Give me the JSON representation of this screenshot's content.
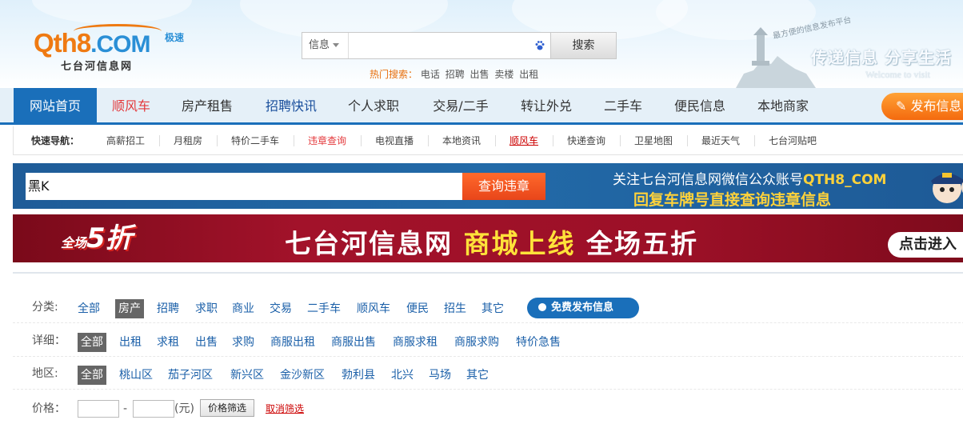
{
  "header": {
    "logo_text": "Qth8",
    "logo_com": ".COM",
    "logo_badge": "极速",
    "logo_sub": "七台河信息网",
    "search_type": "信息",
    "search_value": "",
    "search_button": "搜索",
    "hot_label": "热门搜索：",
    "hot_words": [
      "电话",
      "招聘",
      "出售",
      "卖楼",
      "出租"
    ],
    "tagline": "最方便的信息发布平台",
    "slogan": "传递信息 分享生活",
    "slogan_en": "Welcome to visit"
  },
  "nav": {
    "items": [
      "网站首页",
      "顺风车",
      "房产租售",
      "招聘快讯",
      "个人求职",
      "交易/二手",
      "转让外兑",
      "二手车",
      "便民信息",
      "本地商家"
    ],
    "publish": "发布信息"
  },
  "quick_nav": {
    "label": "快速导航：",
    "items": [
      "高薪招工",
      "月租房",
      "特价二手车",
      "违章查询",
      "电视直播",
      "本地资讯",
      "顺风车",
      "快递查询",
      "卫星地图",
      "最近天气",
      "七台河贴吧"
    ]
  },
  "violation": {
    "input_value": "黑K",
    "button": "查询违章",
    "line1_prefix": "关注七台河信息网微信公众账号",
    "line1_account": "QTH8_COM",
    "line2": "回复车牌号直接查询违章信息"
  },
  "promo": {
    "badge_small": "全场",
    "badge_big": "5折",
    "title_white": "七台河信息网",
    "title_yellow": "商城上线",
    "title_tail": "全场五折",
    "button": "点击进入"
  },
  "filters": {
    "category": {
      "label": "分类:",
      "items": [
        "全部",
        "房产",
        "招聘",
        "求职",
        "商业",
        "交易",
        "二手车",
        "顺风车",
        "便民",
        "招生",
        "其它"
      ],
      "selected": "房产"
    },
    "free_publish": "免费发布信息",
    "detail": {
      "label": "详细：",
      "items": [
        "全部",
        "出租",
        "求租",
        "出售",
        "求购",
        "商服出租",
        "商服出售",
        "商服求租",
        "商服求购",
        "特价急售"
      ],
      "selected": "全部"
    },
    "area": {
      "label": "地区:",
      "items": [
        "全部",
        "桃山区",
        "茄子河区",
        "新兴区",
        "金沙新区",
        "勃利县",
        "北兴",
        "马场",
        "其它"
      ],
      "selected": "全部"
    },
    "price": {
      "label": "价格：",
      "dash": "-",
      "unit": "(元)",
      "button": "价格筛选",
      "cancel": "取消筛选"
    }
  },
  "colors": {
    "brand_blue": "#1a6fba",
    "brand_orange": "#ef7a12",
    "accent_red": "#e4393c"
  }
}
